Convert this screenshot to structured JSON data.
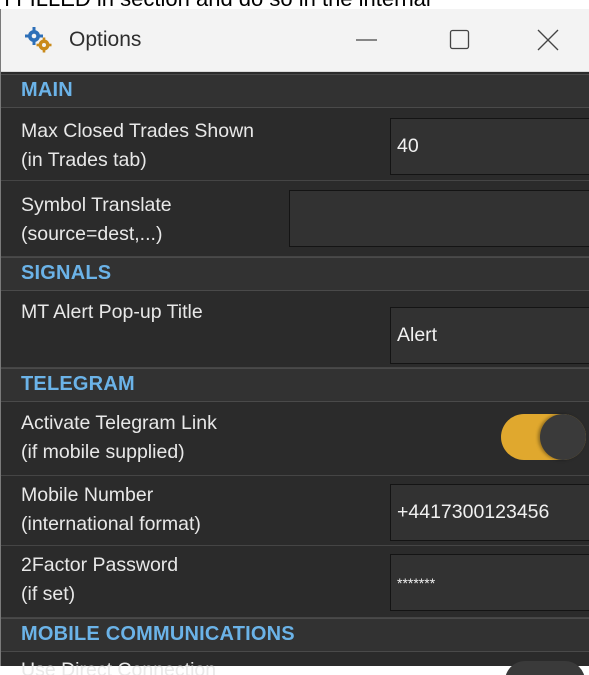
{
  "background_caption": "I FILLED in section and do so in the internal",
  "window": {
    "title": "Options"
  },
  "sections": {
    "main": "MAIN",
    "signals": "SIGNALS",
    "telegram": "TELEGRAM",
    "mobile": "MOBILE COMMUNICATIONS"
  },
  "settings": {
    "max_closed_trades": {
      "line1": "Max Closed Trades Shown",
      "line2": "(in Trades tab)",
      "value": "40"
    },
    "symbol_translate": {
      "line1": "Symbol Translate",
      "line2": "(source=dest,...)",
      "value": ""
    },
    "mt_alert_title": {
      "line1": "MT Alert Pop-up Title",
      "value": "Alert"
    },
    "activate_telegram": {
      "line1": "Activate Telegram Link",
      "line2": "(if mobile supplied)",
      "enabled": true
    },
    "mobile_number": {
      "line1": "Mobile Number",
      "line2": "(international format)",
      "value": "+4417300123456"
    },
    "twofactor_password": {
      "line1": "2Factor Password",
      "line2": "(if set)",
      "value": "*******"
    },
    "direct_connection": {
      "line1": "Use Direct Connection"
    }
  },
  "colors": {
    "accent": "#e0a82e",
    "section_header": "#6bb3e8",
    "panel": "#2b2b2b"
  },
  "icons": {
    "app": "gears-icon",
    "minimize": "minimize-icon",
    "maximize": "maximize-icon",
    "close": "close-icon"
  }
}
